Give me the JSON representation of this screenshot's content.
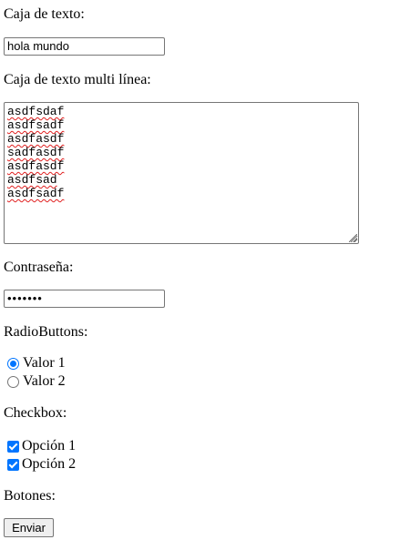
{
  "text_field": {
    "label": "Caja de texto:",
    "value": "hola mundo"
  },
  "textarea": {
    "label": "Caja de texto multi línea:",
    "lines": [
      "asdfsdaf",
      "asdfsadf",
      "asdfasdf",
      "sadfasdf",
      "asdfasdf",
      "asdfsad",
      "asdfsadf"
    ]
  },
  "password": {
    "label": "Contraseña:",
    "masked_value": "•••••••"
  },
  "radios": {
    "label": "RadioButtons:",
    "options": [
      {
        "label": "Valor 1",
        "checked": true
      },
      {
        "label": "Valor 2",
        "checked": false
      }
    ]
  },
  "checkboxes": {
    "label": "Checkbox:",
    "options": [
      {
        "label": "Opción 1",
        "checked": true
      },
      {
        "label": "Opción 2",
        "checked": true
      }
    ]
  },
  "buttons": {
    "label": "Botones:",
    "submit_label": "Enviar"
  },
  "colors": {
    "accent": "#0075ff",
    "spellcheck": "#e02020",
    "border": "#767676",
    "button_bg": "#efefef"
  }
}
